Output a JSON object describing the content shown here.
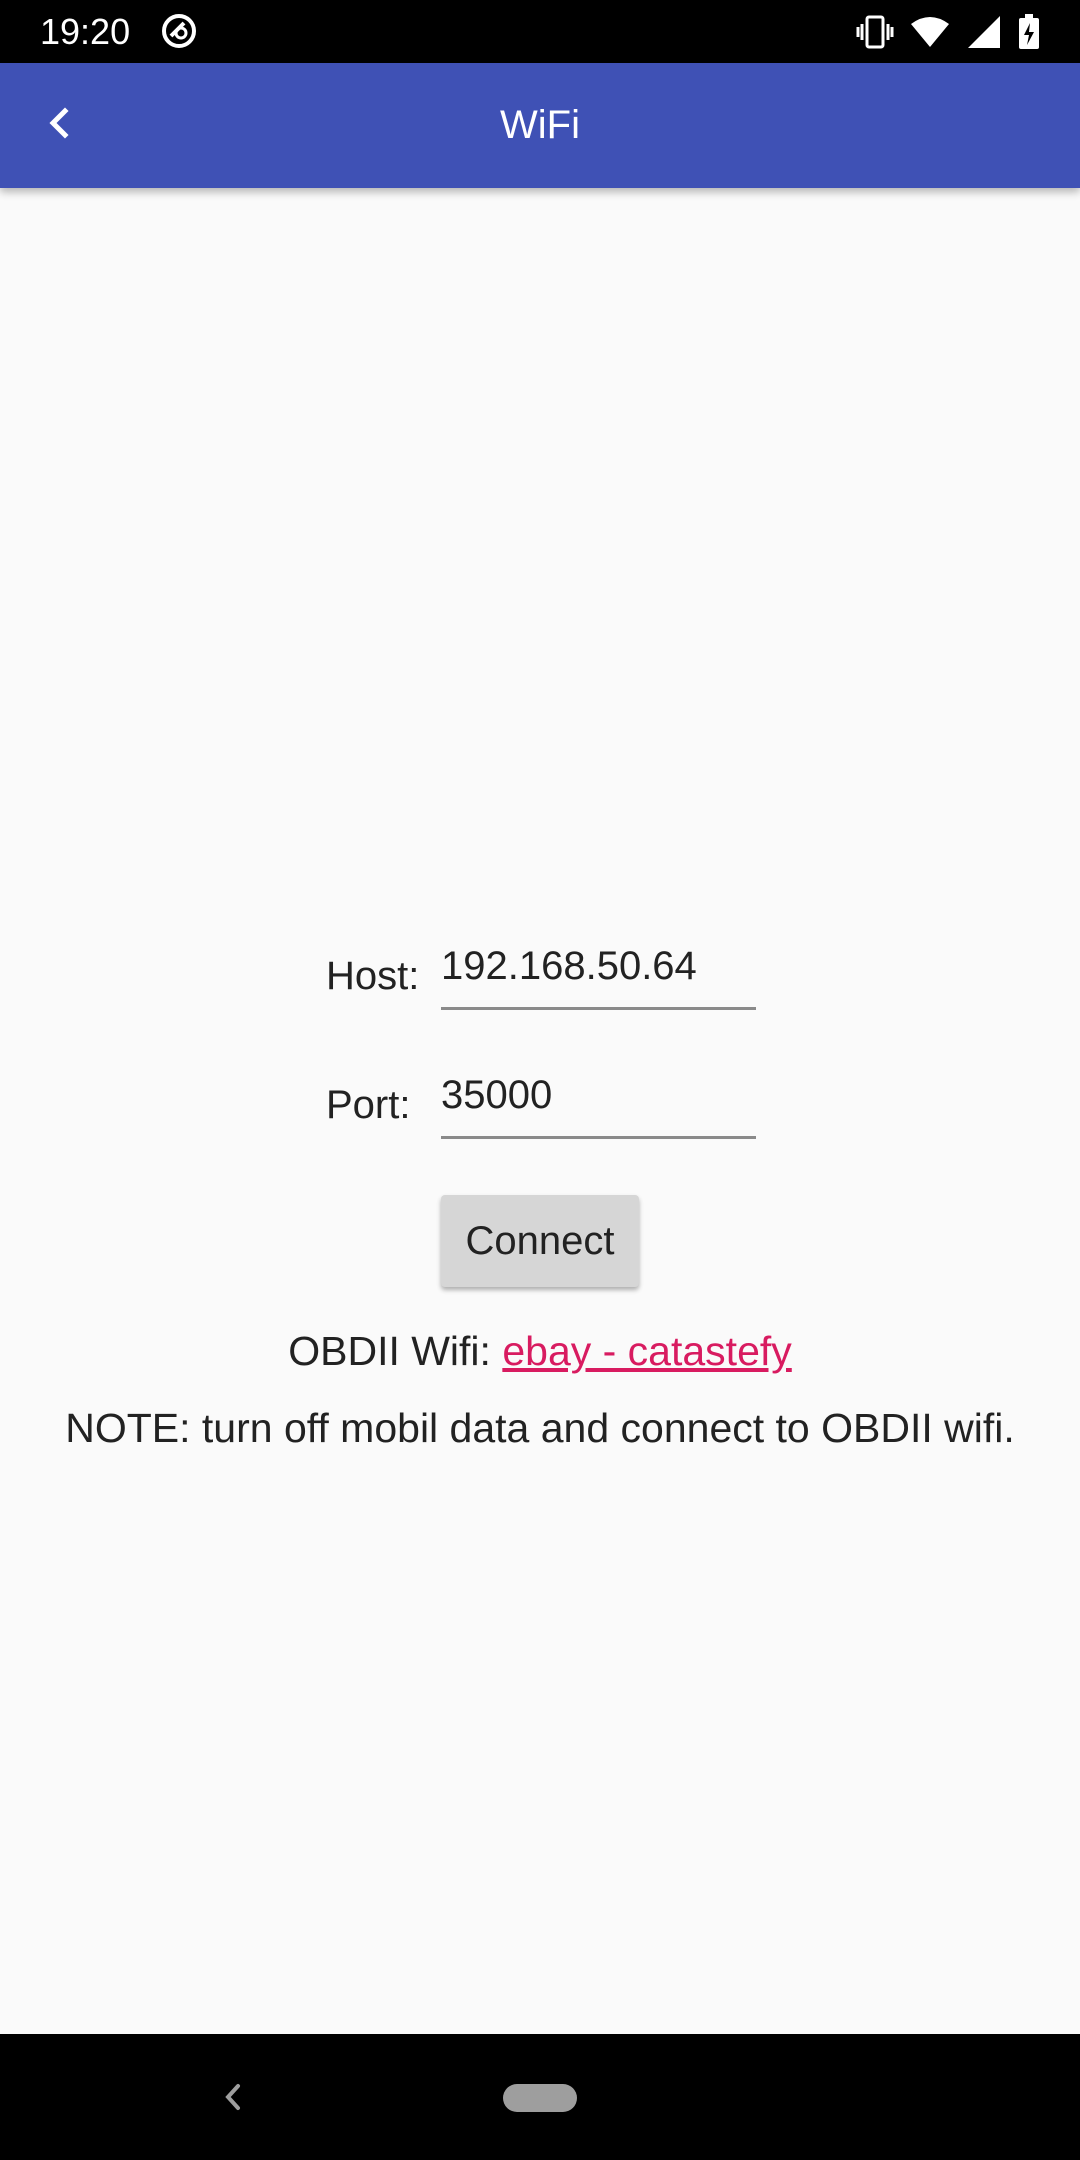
{
  "status_bar": {
    "time": "19:20",
    "icons": [
      "vibrate-icon",
      "wifi-icon",
      "signal-icon",
      "battery-charging-icon"
    ],
    "app_icon": "circle-icon"
  },
  "app_bar": {
    "title": "WiFi",
    "back_icon": "chevron-left-icon",
    "color": "#3f51b5"
  },
  "form": {
    "host_label": "Host:",
    "host_value": "192.168.50.64",
    "port_label": "Port:",
    "port_value": "35000",
    "connect_label": "Connect"
  },
  "info": {
    "obd_prefix": "OBDII Wifi:",
    "obd_link": "ebay - catastefy",
    "link_color": "#d81b60",
    "note": "NOTE: turn off mobil data and connect to OBDII wifi."
  },
  "nav_bar": {
    "back_icon": "nav-back-icon",
    "home_icon": "nav-home-pill"
  }
}
